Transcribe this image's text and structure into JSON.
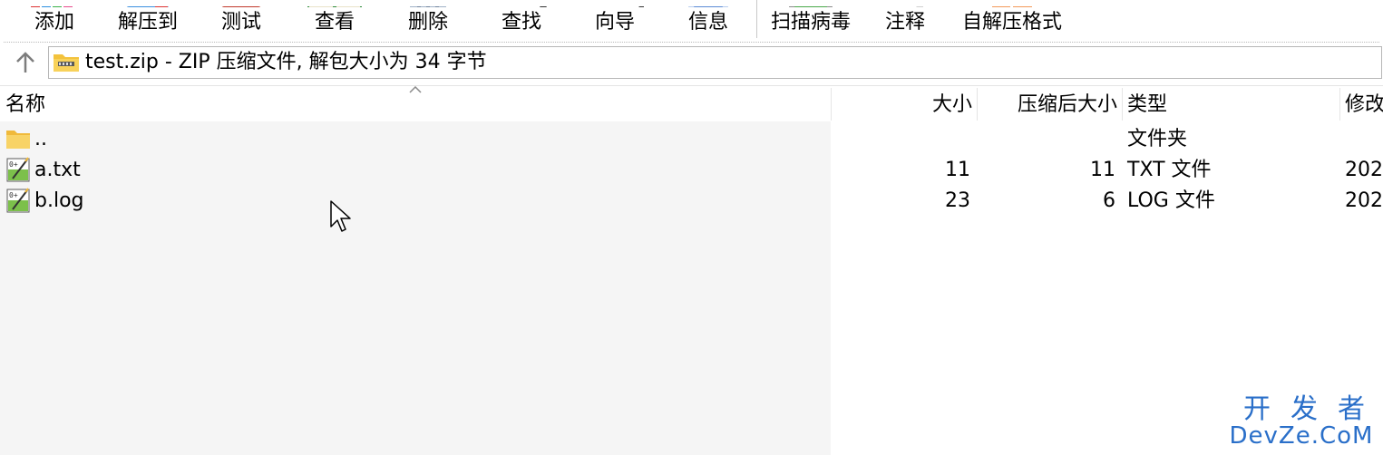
{
  "toolbar": {
    "buttons": [
      {
        "label": "添加",
        "icon": "add-icon",
        "color": "#3a9ae0"
      },
      {
        "label": "解压到",
        "icon": "extract-to-icon",
        "color": "#3a8fe0"
      },
      {
        "label": "测试",
        "icon": "test-icon",
        "color": "#c0392b"
      },
      {
        "label": "查看",
        "icon": "view-icon",
        "color": "#2e8b3a"
      },
      {
        "label": "删除",
        "icon": "delete-icon",
        "color": "#7a8fa8"
      },
      {
        "label": "查找",
        "icon": "find-icon",
        "color": "#333333"
      },
      {
        "label": "向导",
        "icon": "wizard-icon",
        "color": "#333333"
      },
      {
        "label": "信息",
        "icon": "info-icon",
        "color": "#5b8bd6"
      },
      {
        "label": "扫描病毒",
        "icon": "scan-virus-icon",
        "color": "#4aa84a"
      },
      {
        "label": "注释",
        "icon": "comment-icon",
        "color": "#999999"
      },
      {
        "label": "自解压格式",
        "icon": "sfx-icon",
        "color": "#f39a5a"
      }
    ]
  },
  "address": {
    "path": "test.zip - ZIP 压缩文件, 解包大小为 34 字节"
  },
  "columns": {
    "name": "名称",
    "size": "大小",
    "packed": "压缩后大小",
    "type": "类型",
    "modified": "修改"
  },
  "rows": [
    {
      "name": "..",
      "size": "",
      "packed": "",
      "type": "文件夹",
      "modified": "",
      "icon": "folder-icon"
    },
    {
      "name": "a.txt",
      "size": "11",
      "packed": "11",
      "type": "TXT 文件",
      "modified": "202",
      "icon": "text-file-icon"
    },
    {
      "name": "b.log",
      "size": "23",
      "packed": "6",
      "type": "LOG 文件",
      "modified": "202",
      "icon": "text-file-icon"
    }
  ],
  "watermark": {
    "top": "开发者",
    "bottom": "DevZe.CoM"
  },
  "colors": {
    "accent": "#2a6fc9",
    "folder": "#f7c948",
    "name_column_bg": "#f5f5f5"
  }
}
